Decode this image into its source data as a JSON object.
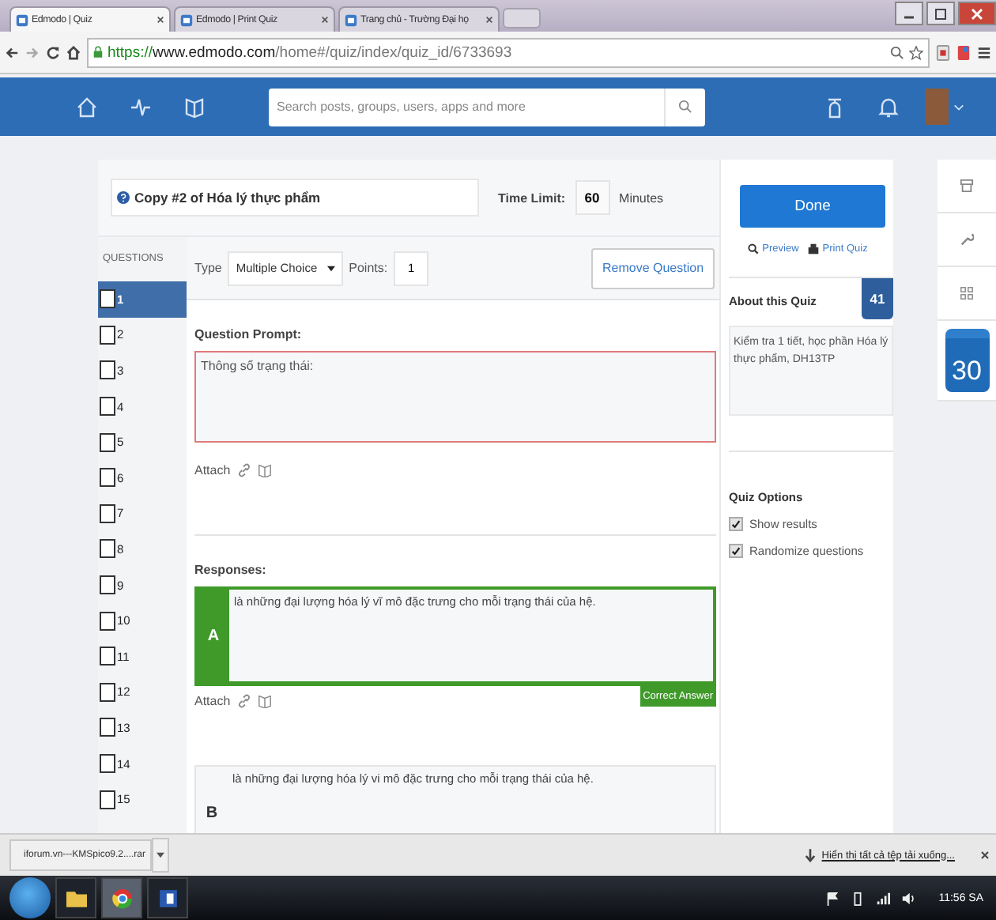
{
  "browser_tabs": [
    {
      "title": "Edmodo | Quiz",
      "selected": true
    },
    {
      "title": "Edmodo | Print Quiz",
      "selected": false
    },
    {
      "title": "Trang chủ - Trường Đại họ",
      "selected": false
    }
  ],
  "address": {
    "scheme": "https://",
    "host": "www.edmodo.com",
    "path": "/home#/quiz/index/quiz_id/6733693"
  },
  "nav": {
    "search_placeholder": "Search posts, groups, users, apps and more"
  },
  "quiz": {
    "title": "Copy #2 of Hóa lý thực phẩm",
    "time_limit_label": "Time Limit:",
    "time_limit": "60",
    "minutes_label": "Minutes"
  },
  "questions": {
    "heading": "QUESTIONS",
    "items": [
      {
        "label": "1",
        "selected": true
      },
      {
        "label": "2",
        "selected": false
      },
      {
        "label": "3",
        "selected": false
      },
      {
        "label": "4",
        "selected": false
      },
      {
        "label": "5",
        "selected": false
      },
      {
        "label": "6",
        "selected": false
      },
      {
        "label": "7",
        "selected": false
      },
      {
        "label": "8",
        "selected": false
      },
      {
        "label": "9",
        "selected": false
      },
      {
        "label": "10",
        "selected": false
      },
      {
        "label": "11",
        "selected": false
      },
      {
        "label": "12",
        "selected": false
      },
      {
        "label": "13",
        "selected": false
      },
      {
        "label": "14",
        "selected": false
      },
      {
        "label": "15",
        "selected": false
      }
    ]
  },
  "editor": {
    "type_label": "Type",
    "type_value": "Multiple Choice",
    "points_label": "Points:",
    "points": "1",
    "remove_button": "Remove Question",
    "prompt_label": "Question Prompt:",
    "prompt_text": "Thông số trạng thái:",
    "attach_label": "Attach",
    "responses_label": "Responses:",
    "responses": [
      {
        "letter": "A",
        "text": "là những đại lượng hóa lý vĩ mô đặc trưng cho mỗi trạng thái của hệ.",
        "correct": true,
        "badge": "Correct Answer",
        "attach_label": "Attach"
      },
      {
        "letter": "B",
        "text": "là những đại lượng hóa lý vi mô đặc trưng cho mỗi trạng thái của hệ.",
        "correct": false
      }
    ]
  },
  "panel": {
    "done_button": "Done",
    "preview_link": "Preview",
    "print_link": "Print Quiz",
    "about_title": "About this Quiz",
    "count": "41",
    "description": "Kiểm tra 1 tiết, học phần Hóa lý thực phẩm, DH13TP",
    "options_title": "Quiz Options",
    "options": [
      {
        "label": "Show results",
        "checked": true
      },
      {
        "label": "Randomize questions",
        "checked": true
      }
    ]
  },
  "side_tabs": {
    "calendar_day": "30"
  },
  "download_bar": {
    "file": "iforum.vn---KMSpico9.2....rar",
    "show_all_link": "Hiển thị tất cả tệp tải xuống..."
  },
  "taskbar": {
    "time": "11:56 SA"
  }
}
